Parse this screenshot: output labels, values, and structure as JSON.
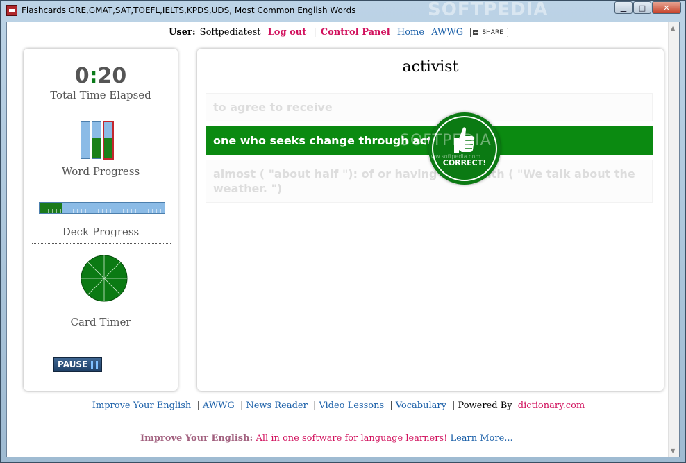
{
  "window": {
    "title": "Flashcards GRE,GMAT,SAT,TOEFL,IELTS,KPDS,UDS, Most Common English Words",
    "watermark": "SOFTPEDIA",
    "min_glyph": "▁",
    "max_glyph": "□",
    "close_glyph": "✕"
  },
  "topnav": {
    "user_label": "User:",
    "username": "Softpediatest",
    "logout": "Log out",
    "separator": "|",
    "control_panel": "Control Panel",
    "home": "Home",
    "awwg": "AWWG",
    "share": "SHARE"
  },
  "sidebar": {
    "timer_minutes": "0",
    "timer_colon": ":",
    "timer_seconds": "20",
    "time_label": "Total Time Elapsed",
    "word_progress_label": "Word Progress",
    "word_progress_levels": [
      0,
      0.55,
      0.55
    ],
    "deck_progress_label": "Deck Progress",
    "deck_progress_fraction": 0.18,
    "card_timer_label": "Card Timer",
    "pause_label": "PAUSE"
  },
  "card": {
    "word": "activist",
    "options": [
      {
        "text": "to agree to receive",
        "state": "faded"
      },
      {
        "text": "one who seeks change through action",
        "state": "correct"
      },
      {
        "text": "almost ( \"about half \"): of or having to do with  ( \"We talk about the weather. \")",
        "state": "faded"
      }
    ],
    "badge_text": "CORRECT!",
    "watermark": "SOFTPEDIA",
    "watermark_sub": "www.softpedia.com"
  },
  "footer": {
    "links": [
      "Improve Your English",
      "AWWG",
      "News Reader",
      "Video Lessons",
      "Vocabulary"
    ],
    "separator": "|",
    "powered_by": "Powered By",
    "dictionary": "dictionary.com"
  },
  "promo": {
    "title": "Improve Your English:",
    "text": "All in one software for language learners!",
    "link": "Learn More..."
  },
  "colors": {
    "accent_green": "#0b8a11",
    "link_blue": "#1a5fa8",
    "link_pink": "#d1115d"
  }
}
